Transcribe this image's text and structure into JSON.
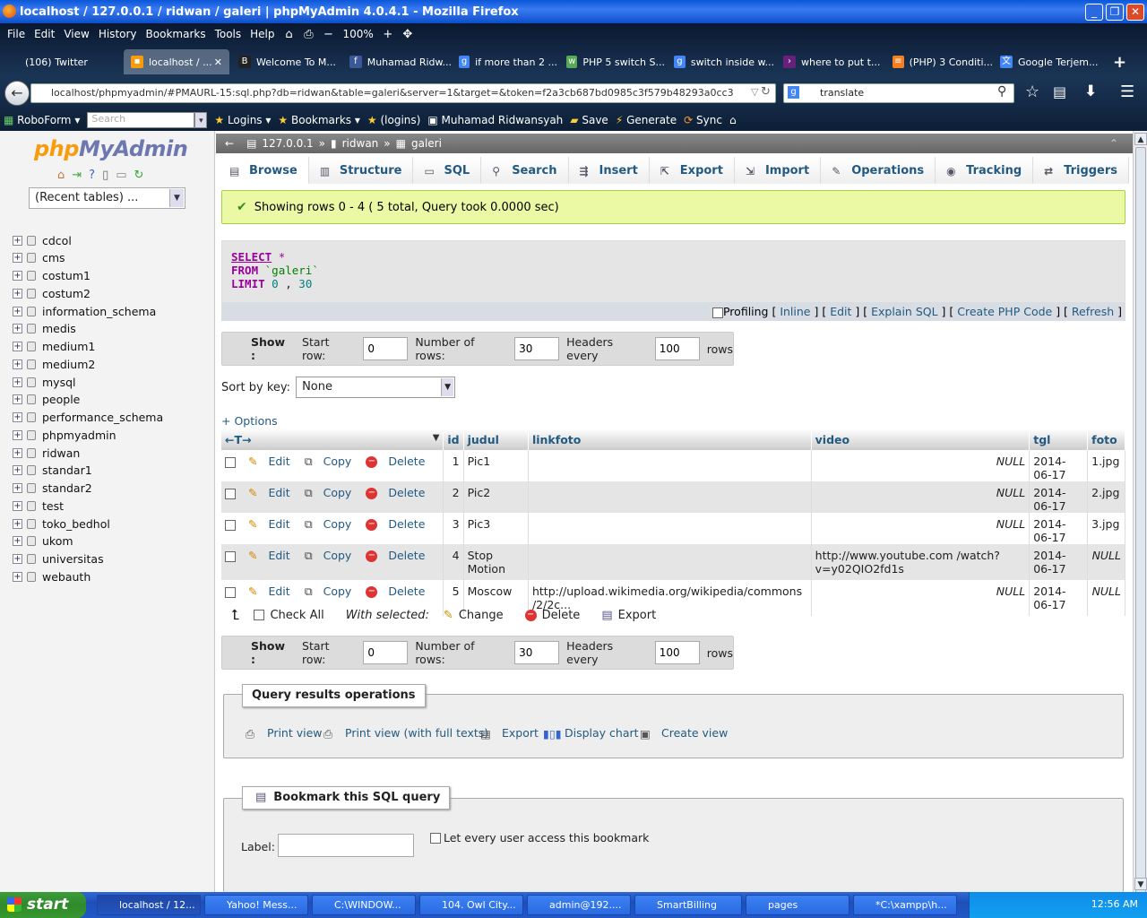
{
  "window": {
    "title": "localhost / 127.0.0.1 / ridwan / galeri | phpMyAdmin 4.0.4.1 - Mozilla Firefox"
  },
  "menubar": {
    "items": [
      "File",
      "Edit",
      "View",
      "History",
      "Bookmarks",
      "Tools",
      "Help"
    ],
    "zoom": "100%"
  },
  "tabs": [
    {
      "label": "(106) Twitter"
    },
    {
      "label": "localhost / ..."
    },
    {
      "label": "Welcome To M..."
    },
    {
      "label": "Muhamad Ridw..."
    },
    {
      "label": "if more than 2 ..."
    },
    {
      "label": "PHP 5 switch S..."
    },
    {
      "label": "switch inside w..."
    },
    {
      "label": "where to put t..."
    },
    {
      "label": "(PHP) 3 Conditi..."
    },
    {
      "label": "Google Terjem..."
    }
  ],
  "nav": {
    "url": "localhost/phpmyadmin/#PMAURL-15:sql.php?db=ridwan&table=galeri&server=1&target=&token=f2a3cb687bd0985c3f579b48293a0cc3",
    "search": "translate"
  },
  "bookmarks": {
    "roboform": "RoboForm",
    "search_placeholder": "Search",
    "items": [
      "Logins",
      "Bookmarks",
      "(logins)",
      "Muhamad Ridwansyah",
      "Save",
      "Generate",
      "Sync"
    ]
  },
  "sidebar": {
    "logo_php": "php",
    "logo_my": "MyAdmin",
    "recent": "(Recent tables) ...",
    "databases": [
      "cdcol",
      "cms",
      "costum1",
      "costum2",
      "information_schema",
      "medis",
      "medium1",
      "medium2",
      "mysql",
      "people",
      "performance_schema",
      "phpmyadmin",
      "ridwan",
      "standar1",
      "standar2",
      "test",
      "toko_bedhol",
      "ukom",
      "universitas",
      "webauth"
    ]
  },
  "breadcrumb": {
    "server": "127.0.0.1",
    "db": "ridwan",
    "table": "galeri"
  },
  "menutabs": [
    "Browse",
    "Structure",
    "SQL",
    "Search",
    "Insert",
    "Export",
    "Import",
    "Operations",
    "Tracking",
    "Triggers"
  ],
  "success": "Showing rows 0 - 4 ( 5 total, Query took 0.0000 sec)",
  "sql": {
    "select": "SELECT",
    "star": "*",
    "from": "FROM",
    "table": "`galeri`",
    "limit": "LIMIT",
    "l0": "0",
    "comma": ",",
    "l1": "30"
  },
  "sqlfooter": {
    "profiling": "Profiling",
    "links": [
      "Inline",
      "Edit",
      "Explain SQL",
      "Create PHP Code",
      "Refresh"
    ]
  },
  "showbar": {
    "show": "Show :",
    "start_row": "Start row:",
    "start_val": "0",
    "num_rows": "Number of rows:",
    "num_val": "30",
    "headers": "Headers every",
    "headers_val": "100",
    "rows": "rows"
  },
  "sort": {
    "label": "Sort by key:",
    "value": "None"
  },
  "options": "+ Options",
  "table": {
    "columns": [
      "id",
      "judul",
      "linkfoto",
      "video",
      "tgl",
      "foto"
    ],
    "actions": {
      "edit": "Edit",
      "copy": "Copy",
      "delete": "Delete"
    },
    "rows": [
      {
        "id": "1",
        "judul": "Pic1",
        "linkfoto": "",
        "video": "NULL",
        "tgl": "2014-06-17",
        "foto": "1.jpg"
      },
      {
        "id": "2",
        "judul": "Pic2",
        "linkfoto": "",
        "video": "NULL",
        "tgl": "2014-06-17",
        "foto": "2.jpg"
      },
      {
        "id": "3",
        "judul": "Pic3",
        "linkfoto": "",
        "video": "NULL",
        "tgl": "2014-06-17",
        "foto": "3.jpg"
      },
      {
        "id": "4",
        "judul": "Stop Motion",
        "linkfoto": "",
        "video": "http://www.youtube.com /watch?v=y02QIO2fd1s",
        "tgl": "2014-06-17",
        "foto": "NULL"
      },
      {
        "id": "5",
        "judul": "Moscow",
        "linkfoto": "http://upload.wikimedia.org/wikipedia/commons /2/2c...",
        "video": "NULL",
        "tgl": "2014-06-17",
        "foto": "NULL"
      }
    ]
  },
  "withselected": {
    "check_all": "Check All",
    "label": "With selected:",
    "change": "Change",
    "delete": "Delete",
    "export": "Export"
  },
  "queryops": {
    "legend": "Query results operations",
    "items": [
      "Print view",
      "Print view (with full texts)",
      "Export",
      "Display chart",
      "Create view"
    ]
  },
  "bookmark": {
    "legend": "Bookmark this SQL query",
    "label": "Label:",
    "share": "Let every user access this bookmark"
  },
  "taskbar": {
    "start": "start",
    "tasks": [
      "localhost / 12...",
      "Yahoo! Mess...",
      "C:\\WINDOW...",
      "104. Owl City...",
      "admin@192....",
      "SmartBilling",
      "pages",
      "*C:\\xampp\\h..."
    ],
    "clock": "12:56 AM"
  }
}
